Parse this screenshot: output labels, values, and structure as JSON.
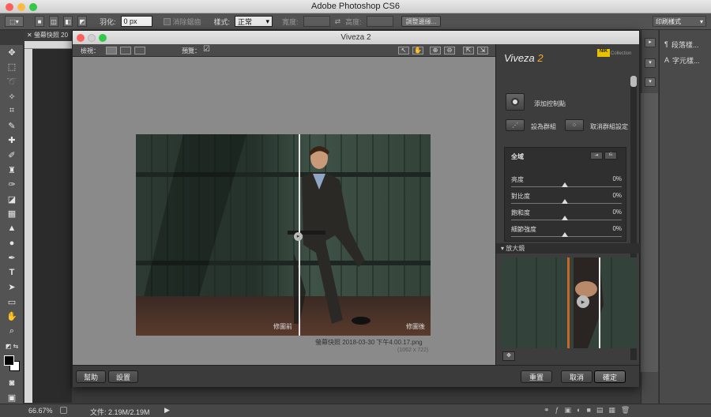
{
  "app": {
    "title": "Adobe Photoshop CS6"
  },
  "options_bar": {
    "feather_label": "羽化:",
    "feather_value": "0 px",
    "antialias_label": "消除鋸齒",
    "style_label": "樣式:",
    "style_value": "正常",
    "width_label": "寬度:",
    "height_label": "高度:",
    "refine_edge_button": "調整邊緣...",
    "workspace_select": "印刷樣式"
  },
  "document_tab": {
    "label": "螢幕快照 20"
  },
  "status_bar": {
    "zoom": "66.67%",
    "doc_info": "文件: 2.19M/2.19M"
  },
  "right_panel": {
    "items": [
      "段落樣...",
      "字元樣..."
    ]
  },
  "viveza": {
    "window_title": "Viveza 2",
    "view_label": "檢視：",
    "preview_label": "預覽：",
    "before_label": "修圖前",
    "after_label": "修圖後",
    "file_name": "螢幕快照 2018-03-30 下午4.00.17.png",
    "file_dims": "(1062 x 722)",
    "logo_name": "Viveza",
    "logo_version": "2",
    "nik_badge": "NIK",
    "collection_label": "Collection",
    "add_control_point": "添加控制點",
    "group": "設為群組",
    "ungroup": "取消群組設定",
    "global_label": "全域",
    "sliders": [
      {
        "label": "亮度",
        "value": "0%"
      },
      {
        "label": "對比度",
        "value": "0%"
      },
      {
        "label": "飽和度",
        "value": "0%"
      },
      {
        "label": "細節強度",
        "value": "0%"
      }
    ],
    "loupe_label": "放大鏡",
    "buttons": {
      "help": "幫助",
      "settings": "設置",
      "reset": "重置",
      "cancel": "取消",
      "ok": "確定"
    }
  }
}
